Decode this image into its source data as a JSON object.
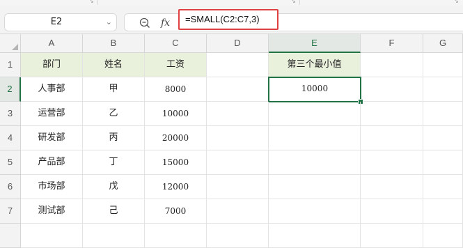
{
  "name_box": {
    "value": "E2"
  },
  "formula_bar": {
    "formula": "=SMALL(C2:C7,3)",
    "fx_label": "fx"
  },
  "columns": [
    "A",
    "B",
    "C",
    "D",
    "E",
    "F",
    "G"
  ],
  "rows": [
    "1",
    "2",
    "3",
    "4",
    "5",
    "6",
    "7",
    ""
  ],
  "table": {
    "headers": [
      "部门",
      "姓名",
      "工资"
    ],
    "rows": [
      [
        "人事部",
        "甲",
        "8000"
      ],
      [
        "运营部",
        "乙",
        "10000"
      ],
      [
        "研发部",
        "丙",
        "20000"
      ],
      [
        "产品部",
        "丁",
        "15000"
      ],
      [
        "市场部",
        "戊",
        "12000"
      ],
      [
        "测试部",
        "己",
        "7000"
      ]
    ]
  },
  "result": {
    "label": "第三个最小值",
    "value": "10000"
  },
  "selected_cell": "E2",
  "colors": {
    "accent": "#217346",
    "header_fill": "#e9f1dd",
    "highlight": "#e04040"
  }
}
